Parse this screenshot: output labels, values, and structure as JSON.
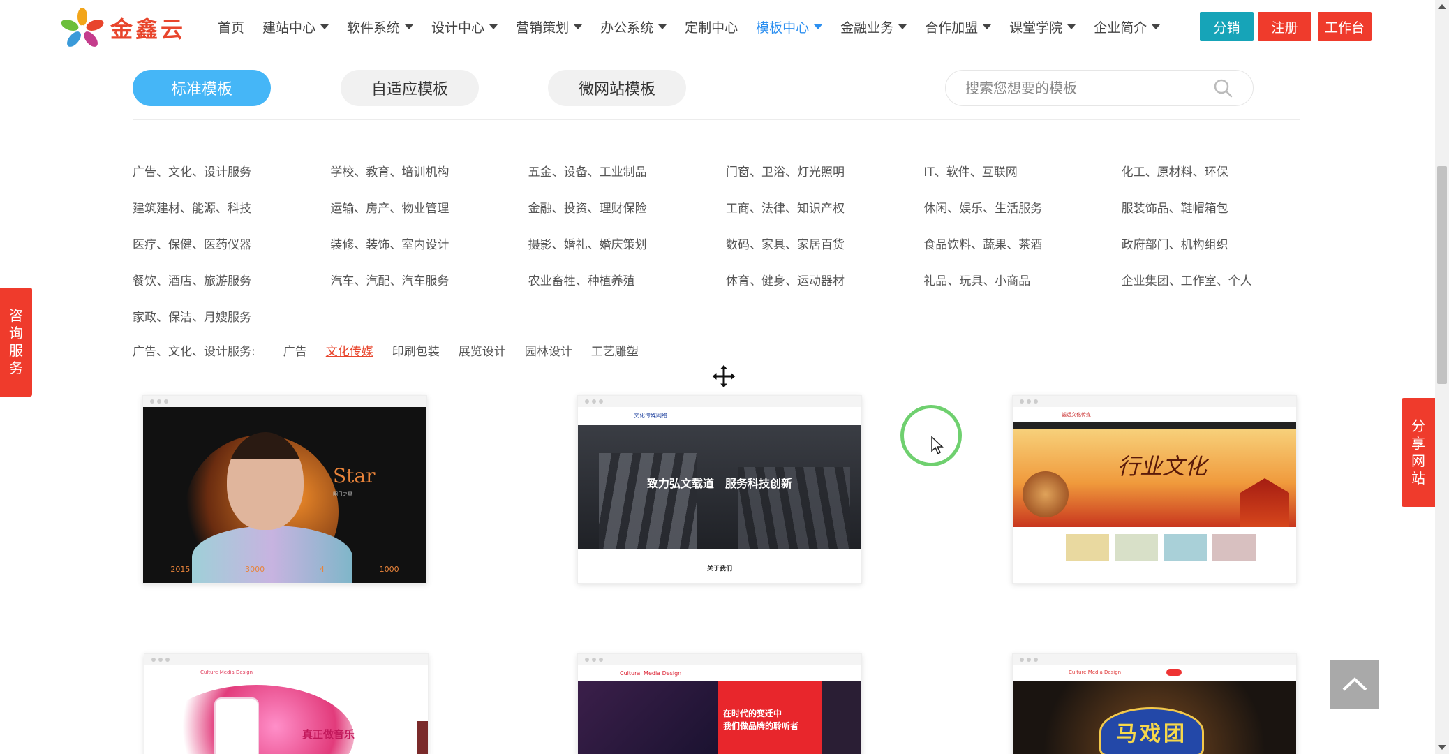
{
  "header": {
    "logo_text": "金鑫云",
    "nav": [
      {
        "label": "首页",
        "dropdown": false,
        "active": false
      },
      {
        "label": "建站中心",
        "dropdown": true,
        "active": false
      },
      {
        "label": "软件系统",
        "dropdown": true,
        "active": false
      },
      {
        "label": "设计中心",
        "dropdown": true,
        "active": false
      },
      {
        "label": "营销策划",
        "dropdown": true,
        "active": false
      },
      {
        "label": "办公系统",
        "dropdown": true,
        "active": false
      },
      {
        "label": "定制中心",
        "dropdown": false,
        "active": false
      },
      {
        "label": "模板中心",
        "dropdown": true,
        "active": true
      },
      {
        "label": "金融业务",
        "dropdown": true,
        "active": false
      },
      {
        "label": "合作加盟",
        "dropdown": true,
        "active": false
      },
      {
        "label": "课堂学院",
        "dropdown": true,
        "active": false
      },
      {
        "label": "企业简介",
        "dropdown": true,
        "active": false
      }
    ],
    "buttons": {
      "distribute": "分销",
      "register": "注册",
      "workbench": "工作台"
    }
  },
  "tabs": {
    "standard": "标准模板",
    "responsive": "自适应模板",
    "mobile": "微网站模板"
  },
  "search": {
    "placeholder": "搜索您想要的模板",
    "value": ""
  },
  "categories": [
    [
      "广告、文化、设计服务",
      "学校、教育、培训机构",
      "五金、设备、工业制品",
      "门窗、卫浴、灯光照明",
      "IT、软件、互联网",
      "化工、原材料、环保"
    ],
    [
      "建筑建材、能源、科技",
      "运输、房产、物业管理",
      "金融、投资、理财保险",
      "工商、法律、知识产权",
      "休闲、娱乐、生活服务",
      "服装饰品、鞋帽箱包"
    ],
    [
      "医疗、保健、医药仪器",
      "装修、装饰、室内设计",
      "摄影、婚礼、婚庆策划",
      "数码、家具、家居百货",
      "食品饮料、蔬果、茶酒",
      "政府部门、机构组织"
    ],
    [
      "餐饮、酒店、旅游服务",
      "汽车、汽配、汽车服务",
      "农业畜牲、种植养殖",
      "体育、健身、运动器材",
      "礼品、玩具、小商品",
      "企业集团、工作室、个人"
    ],
    [
      "家政、保洁、月嫂服务"
    ]
  ],
  "subcategory": {
    "label": "广告、文化、设计服务:",
    "items": [
      "广告",
      "文化传媒",
      "印刷包装",
      "展览设计",
      "园林设计",
      "工艺雕塑"
    ],
    "active_index": 1
  },
  "cards": {
    "c1": {
      "big": "Star",
      "mini": "明日之星",
      "stats": [
        "2015",
        "3000",
        "4",
        "1000"
      ]
    },
    "c2": {
      "brand": "文化传媒网络",
      "slogan": "致力弘文载道　服务科技创新",
      "about": "关于我们"
    },
    "c3": {
      "brand": "诚远文化传媒",
      "title": "行业文化"
    },
    "c4": {
      "brand": "Culture Media Design",
      "text": "真正做音乐"
    },
    "c5": {
      "brand": "Cultural Media Design",
      "text1": "在时代的变迁中",
      "text2": "我们做品牌的聆听者"
    },
    "c6": {
      "brand": "Culture Media Design",
      "sign": "马戏团"
    }
  },
  "side": {
    "consult": [
      "咨",
      "询",
      "服",
      "务"
    ],
    "share": [
      "分",
      "享",
      "网",
      "站"
    ]
  },
  "colors": {
    "accent_blue": "#45b6f7",
    "nav_active": "#2c8ff0",
    "brand_red": "#ef3b2c",
    "teal": "#16a4b8"
  }
}
